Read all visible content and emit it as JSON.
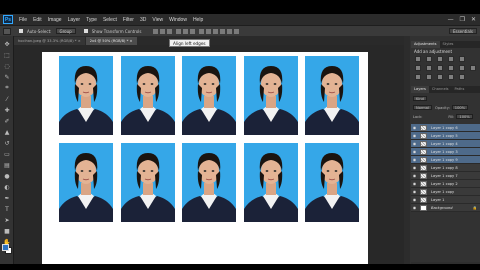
{
  "app": {
    "logo": "Ps"
  },
  "menu": [
    "File",
    "Edit",
    "Image",
    "Layer",
    "Type",
    "Select",
    "Filter",
    "3D",
    "View",
    "Window",
    "Help"
  ],
  "window_controls": [
    "—",
    "❐",
    "✕"
  ],
  "options_bar": {
    "auto_select_label": "Auto-Select:",
    "auto_select_value": "Group",
    "show_transform_label": "Show Transform Controls",
    "workspace": "Essentials"
  },
  "tooltip": "Align left edges",
  "tabs": [
    {
      "label": "hoclhan.jpeg @ 33.3% (RGB/8) *  ×"
    },
    {
      "label": "2x4 @ 50% (RGB/8) *  ×"
    }
  ],
  "panels": {
    "top_tabs": [
      "Adjustments",
      "Styles"
    ],
    "adjustments_title": "Add an adjustment",
    "layer_tabs": [
      "Layers",
      "Channels",
      "Paths"
    ],
    "kind_label": "Kind",
    "blend_mode": "Normal",
    "opacity_label": "Opacity:",
    "opacity_value": "100%",
    "lock_label": "Lock:",
    "fill_label": "Fill:",
    "fill_value": "100%"
  },
  "layers": [
    {
      "name": "Layer 1 copy 6",
      "selected": true
    },
    {
      "name": "Layer 1 copy 5",
      "selected": true
    },
    {
      "name": "Layer 1 copy 4",
      "selected": true
    },
    {
      "name": "Layer 1 copy 3",
      "selected": true
    },
    {
      "name": "Layer 1 copy 9",
      "selected": true
    },
    {
      "name": "Layer 1 copy 8",
      "selected": false
    },
    {
      "name": "Layer 1 copy 7",
      "selected": false
    },
    {
      "name": "Layer 1 copy 2",
      "selected": false
    },
    {
      "name": "Layer 1 copy",
      "selected": false
    },
    {
      "name": "Layer 1",
      "selected": false
    },
    {
      "name": "Background",
      "selected": false,
      "italic": true,
      "locked": true
    }
  ],
  "layer_footer_icons": [
    "link-icon",
    "fx-icon",
    "mask-icon",
    "adjustment-icon",
    "folder-icon",
    "new-layer-icon",
    "trash-icon"
  ],
  "colors": {
    "photo_background": "#35a7e8",
    "selected_layer": "#4e6a8a",
    "app_dark": "#282828"
  },
  "tools": [
    "move-icon",
    "marquee-icon",
    "lasso-icon",
    "quick-select-icon",
    "crop-icon",
    "eyedropper-icon",
    "healing-icon",
    "brush-icon",
    "clone-stamp-icon",
    "history-brush-icon",
    "eraser-icon",
    "gradient-icon",
    "blur-icon",
    "dodge-icon",
    "pen-icon",
    "type-icon",
    "path-select-icon",
    "shape-icon",
    "hand-icon",
    "zoom-icon"
  ],
  "document": {
    "photo_count": 10,
    "rows": 2,
    "columns": 5
  }
}
